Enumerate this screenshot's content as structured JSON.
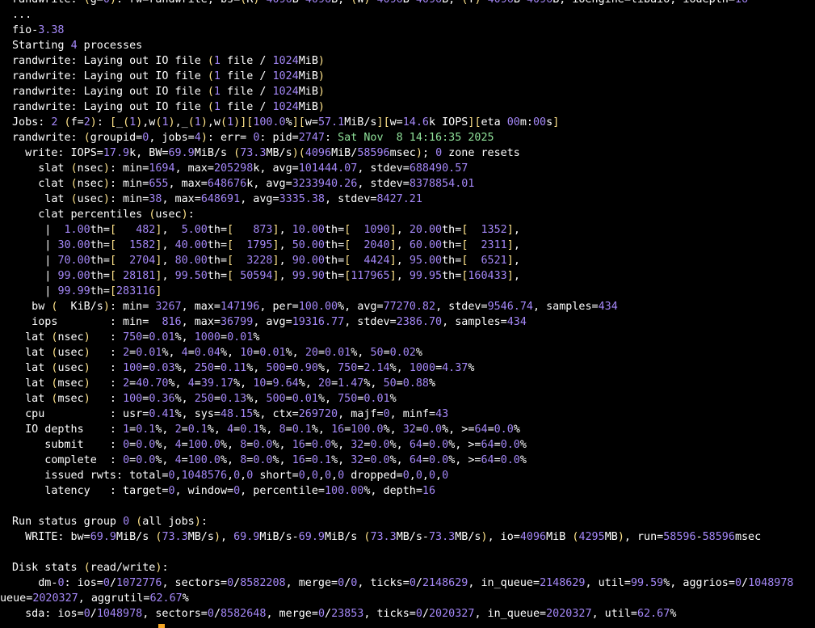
{
  "terminal": {
    "lines": [
      "randwrite: (g=0): rw=randwrite, bs=(R) 4096B-4096B, (W) 4096B-4096B, (T) 4096B-4096B, ioengine=libaio, iodepth=16",
      "...",
      "fio-3.38",
      "Starting 4 processes",
      "randwrite: Laying out IO file (1 file / 1024MiB)",
      "randwrite: Laying out IO file (1 file / 1024MiB)",
      "randwrite: Laying out IO file (1 file / 1024MiB)",
      "randwrite: Laying out IO file (1 file / 1024MiB)",
      "Jobs: 2 (f=2): [_(1),w(1),_(1),w(1)][100.0%][w=57.1MiB/s][w=14.6k IOPS][eta 00m:00s]",
      "randwrite: (groupid=0, jobs=4): err= 0: pid=2747: Sat Nov  8 14:16:35 2025",
      "  write: IOPS=17.9k, BW=69.9MiB/s (73.3MB/s)(4096MiB/58596msec); 0 zone resets",
      "    slat (nsec): min=1694, max=205298k, avg=101444.07, stdev=688490.57",
      "    clat (nsec): min=655, max=648676k, avg=3233940.26, stdev=8378854.01",
      "     lat (usec): min=38, max=648691, avg=3335.38, stdev=8427.21",
      "    clat percentiles (usec):",
      "     |  1.00th=[   482],  5.00th=[   873], 10.00th=[  1090], 20.00th=[  1352],",
      "     | 30.00th=[  1582], 40.00th=[  1795], 50.00th=[  2040], 60.00th=[  2311],",
      "     | 70.00th=[  2704], 80.00th=[  3228], 90.00th=[  4424], 95.00th=[  6521],",
      "     | 99.00th=[ 28181], 99.50th=[ 50594], 99.90th=[117965], 99.95th=[160433],",
      "     | 99.99th=[283116]",
      "   bw (  KiB/s): min= 3267, max=147196, per=100.00%, avg=77270.82, stdev=9546.74, samples=434",
      "   iops        : min=  816, max=36799, avg=19316.77, stdev=2386.70, samples=434",
      "  lat (nsec)   : 750=0.01%, 1000=0.01%",
      "  lat (usec)   : 2=0.01%, 4=0.04%, 10=0.01%, 20=0.01%, 50=0.02%",
      "  lat (usec)   : 100=0.03%, 250=0.11%, 500=0.90%, 750=2.14%, 1000=4.37%",
      "  lat (msec)   : 2=40.70%, 4=39.17%, 10=9.64%, 20=1.47%, 50=0.88%",
      "  lat (msec)   : 100=0.36%, 250=0.13%, 500=0.01%, 750=0.01%",
      "  cpu          : usr=0.41%, sys=48.15%, ctx=269720, majf=0, minf=43",
      "  IO depths    : 1=0.1%, 2=0.1%, 4=0.1%, 8=0.1%, 16=100.0%, 32=0.0%, >=64=0.0%",
      "     submit    : 0=0.0%, 4=100.0%, 8=0.0%, 16=0.0%, 32=0.0%, 64=0.0%, >=64=0.0%",
      "     complete  : 0=0.0%, 4=100.0%, 8=0.0%, 16=0.1%, 32=0.0%, 64=0.0%, >=64=0.0%",
      "     issued rwts: total=0,1048576,0,0 short=0,0,0,0 dropped=0,0,0,0",
      "     latency   : target=0, window=0, percentile=100.00%, depth=16",
      "",
      "Run status group 0 (all jobs):",
      "  WRITE: bw=69.9MiB/s (73.3MB/s), 69.9MiB/s-69.9MiB/s (73.3MB/s-73.3MB/s), io=4096MiB (4295MB), run=58596-58596msec",
      "",
      "Disk stats (read/write):",
      "    dm-0: ios=0/1072776, sectors=0/8582208, merge=0/0, ticks=0/2148629, in_queue=2148629, util=99.59%, aggrios=0/1048978",
      "ueue=2020327, aggrutil=62.67%",
      "  sda: ios=0/1048978, sectors=0/8582648, merge=0/23853, ticks=0/2020327, in_queue=2020327, util=62.67%"
    ]
  },
  "colors": {
    "background": "#000000",
    "text": "#ffffff",
    "number": "#a487f7",
    "bracket": "#ffe38a",
    "string": "#90e29a",
    "cursor": "#f5a623"
  }
}
